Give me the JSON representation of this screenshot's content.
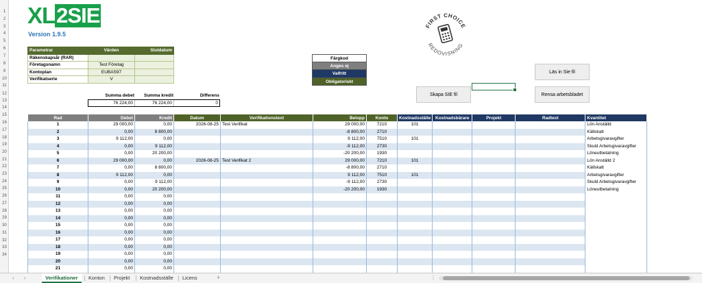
{
  "app": {
    "logo_part1": "XL",
    "logo_part2": "2SIE",
    "version": "Version 1.9.5"
  },
  "row_numbers": [
    "1",
    "2",
    "3",
    "4",
    "5",
    "6",
    "7",
    "8",
    "9",
    "10",
    "11",
    "12",
    "13",
    "14",
    "15",
    "16",
    "17",
    "18",
    "19",
    "20",
    "21",
    "22",
    "23",
    "24",
    "25",
    "26",
    "27",
    "28",
    "29",
    "30",
    "31",
    "32",
    "33",
    "34"
  ],
  "params": {
    "headers": [
      "Parametrar",
      "Värden",
      "Slutdatum"
    ],
    "rows": [
      {
        "label": "Räkenskapsår (RAR)",
        "value": "",
        "end": ""
      },
      {
        "label": "Företagsnamn",
        "value": "Test Företag",
        "end": ""
      },
      {
        "label": "Kontoplan",
        "value": "EUBAS97",
        "end": ""
      },
      {
        "label": "Verifikatserie",
        "value": "V",
        "end": ""
      }
    ]
  },
  "colorkey": {
    "items": [
      {
        "label": "Färgkod",
        "bg": "#ffffff",
        "fg": "#000000"
      },
      {
        "label": "Anges ej",
        "bg": "#7f7f7f",
        "fg": "#ffffff"
      },
      {
        "label": "Valfritt",
        "bg": "#1f3864",
        "fg": "#ffffff"
      },
      {
        "label": "Obligatoriskt",
        "bg": "#4f6228",
        "fg": "#ffffff"
      }
    ]
  },
  "stamp": {
    "top_text": "FIRST CHOICE",
    "bottom_text": "REDOVISNING"
  },
  "buttons": {
    "las_in": "Läs in Sie fil",
    "skapa": "Skapa SIE fil",
    "rensa": "Rensa arbetsbladet"
  },
  "summary": {
    "labels": [
      "Summa debet",
      "Summa kredit",
      "Differens"
    ],
    "values": [
      "76 224,00",
      "76 224,00",
      "0"
    ]
  },
  "grid": {
    "headers": [
      {
        "label": "Rad",
        "color": "#7f7f7f"
      },
      {
        "label": "Debet",
        "color": "#7f7f7f"
      },
      {
        "label": "Kredit",
        "color": "#7f7f7f"
      },
      {
        "label": "Datum",
        "color": "#4f6228"
      },
      {
        "label": "Verifikationstext",
        "color": "#4f6228"
      },
      {
        "label": "Belopp",
        "color": "#4f6228"
      },
      {
        "label": "Konto",
        "color": "#4f6228"
      },
      {
        "label": "Kostnadsställe",
        "color": "#1f3864"
      },
      {
        "label": "Kostnadsbärare",
        "color": "#1f3864"
      },
      {
        "label": "Projekt",
        "color": "#1f3864"
      },
      {
        "label": "Radtext",
        "color": "#1f3864"
      },
      {
        "label": "Kvantitet",
        "color": "#1f3864"
      }
    ],
    "rows": [
      [
        "1",
        "29 000,00",
        "0,00",
        "2026-08-25",
        "Test Verifikat",
        "29 000,00",
        "7210",
        "101",
        "",
        "",
        "",
        "Lön Anställd"
      ],
      [
        "2",
        "0,00",
        "8 800,00",
        "",
        "",
        "-8 800,00",
        "2710",
        "",
        "",
        "",
        "",
        "Källskatt"
      ],
      [
        "3",
        "9 112,00",
        "0,00",
        "",
        "",
        "9 112,00",
        "7510",
        "101",
        "",
        "",
        "",
        "Arbetsgivaravgifter"
      ],
      [
        "4",
        "0,00",
        "9 112,00",
        "",
        "",
        "-9 112,00",
        "2730",
        "",
        "",
        "",
        "",
        "Skuld Arbetsgivaravgifter"
      ],
      [
        "5",
        "0,00",
        "20 200,00",
        "",
        "",
        "-20 200,00",
        "1930",
        "",
        "",
        "",
        "",
        "Löneutbetalning"
      ],
      [
        "6",
        "29 000,00",
        "0,00",
        "2026-08-25",
        "Test Verifikat 2",
        "29 000,00",
        "7210",
        "101",
        "",
        "",
        "",
        "Lön Anställd 2"
      ],
      [
        "7",
        "0,00",
        "8 800,00",
        "",
        "",
        "-8 800,00",
        "2710",
        "",
        "",
        "",
        "",
        "Källskatt"
      ],
      [
        "8",
        "9 112,00",
        "0,00",
        "",
        "",
        "9 112,00",
        "7510",
        "101",
        "",
        "",
        "",
        "Arbetsgivaravgifter"
      ],
      [
        "9",
        "0,00",
        "9 112,00",
        "",
        "",
        "-9 112,00",
        "2730",
        "",
        "",
        "",
        "",
        "Skuld Arbetsgivaravgifter"
      ],
      [
        "10",
        "0,00",
        "20 200,00",
        "",
        "",
        "-20 200,00",
        "1930",
        "",
        "",
        "",
        "",
        "Löneutbetalning"
      ],
      [
        "11",
        "0,00",
        "0,00",
        "",
        "",
        "",
        "",
        "",
        "",
        "",
        "",
        ""
      ],
      [
        "12",
        "0,00",
        "0,00",
        "",
        "",
        "",
        "",
        "",
        "",
        "",
        "",
        ""
      ],
      [
        "13",
        "0,00",
        "0,00",
        "",
        "",
        "",
        "",
        "",
        "",
        "",
        "",
        ""
      ],
      [
        "14",
        "0,00",
        "0,00",
        "",
        "",
        "",
        "",
        "",
        "",
        "",
        "",
        ""
      ],
      [
        "15",
        "0,00",
        "0,00",
        "",
        "",
        "",
        "",
        "",
        "",
        "",
        "",
        ""
      ],
      [
        "16",
        "0,00",
        "0,00",
        "",
        "",
        "",
        "",
        "",
        "",
        "",
        "",
        ""
      ],
      [
        "17",
        "0,00",
        "0,00",
        "",
        "",
        "",
        "",
        "",
        "",
        "",
        "",
        ""
      ],
      [
        "18",
        "0,00",
        "0,00",
        "",
        "",
        "",
        "",
        "",
        "",
        "",
        "",
        ""
      ],
      [
        "19",
        "0,00",
        "0,00",
        "",
        "",
        "",
        "",
        "",
        "",
        "",
        "",
        ""
      ],
      [
        "20",
        "0,00",
        "0,00",
        "",
        "",
        "",
        "",
        "",
        "",
        "",
        "",
        ""
      ],
      [
        "21",
        "0,00",
        "0,00",
        "",
        "",
        "",
        "",
        "",
        "",
        "",
        "",
        ""
      ]
    ]
  },
  "tabs": {
    "items": [
      "Verifikationer",
      "Konton",
      "Projekt",
      "Kostnadsställe",
      "Licens"
    ],
    "active": 0,
    "add_label": "+",
    "nav_left": "‹",
    "nav_right": "›",
    "more": "⋮"
  }
}
